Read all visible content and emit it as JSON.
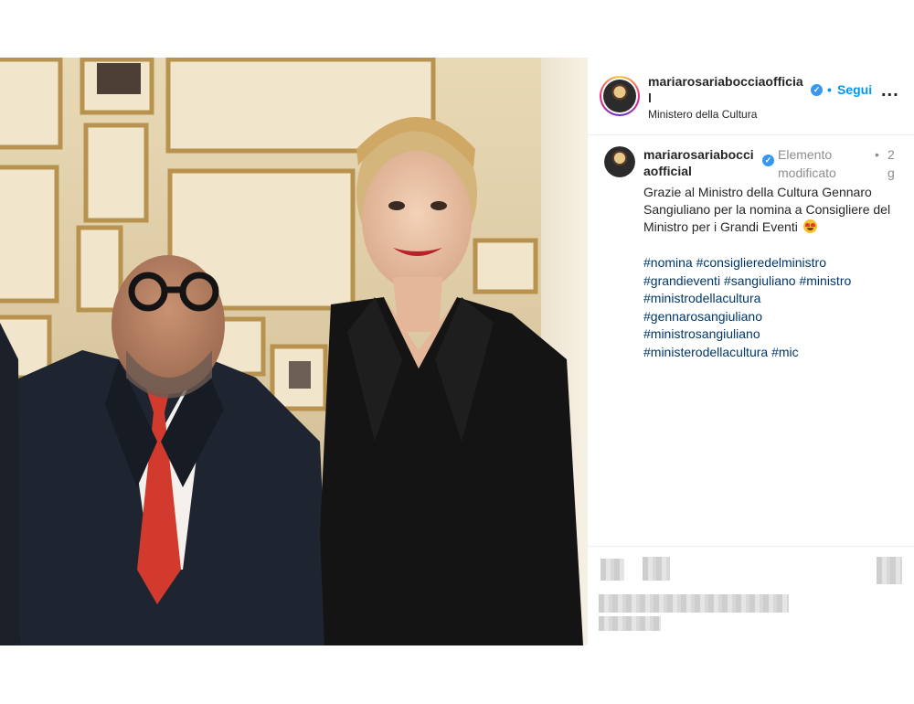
{
  "header": {
    "username": "mariarosariabocciaofficial",
    "username_lines": [
      "mariarosariabocciaofficia",
      "l"
    ],
    "follow_label": "Segui",
    "separator": "•",
    "more_label": "...",
    "location": "Ministero della Cultura"
  },
  "caption": {
    "username_lines": [
      "mariarosariabocci",
      "aofficial"
    ],
    "edited_lines": [
      "Elemento",
      "modificato"
    ],
    "separator": "•",
    "time_lines": [
      "2",
      "g"
    ],
    "text": "Grazie al Ministro della Cultura Gennaro Sangiuliano per la nomina a Consigliere del Ministro per i Grandi Eventi",
    "emoji": "heart-eyes-emoji",
    "hashtags": [
      "#nomina",
      "#consiglieredelministro",
      "#grandieventi",
      "#sangiuliano",
      "#ministro",
      "#ministrodellacultura",
      "#gennarosangiuliano",
      "#ministrosangiuliano",
      "#ministerodellacultura",
      "#mic"
    ]
  },
  "colors": {
    "link": "#00376b",
    "follow": "#0095f6",
    "verified": "#3897f0",
    "muted": "#8e8e8e"
  }
}
